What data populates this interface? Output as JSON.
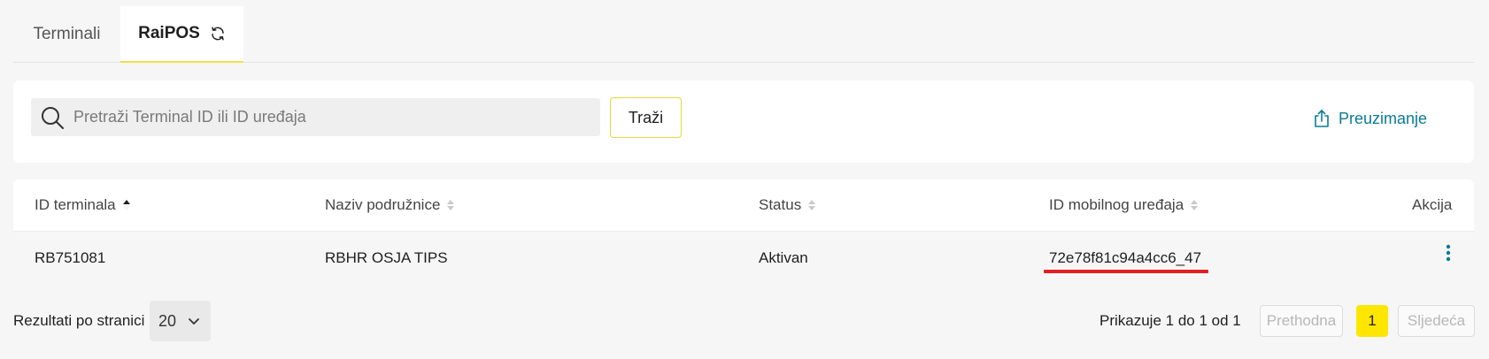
{
  "tabs": [
    {
      "label": "Terminali"
    },
    {
      "label": "RaiPOS"
    }
  ],
  "search": {
    "placeholder": "Pretraži Terminal ID ili ID uređaja",
    "button_label": "Traži",
    "download_label": "Preuzimanje"
  },
  "table": {
    "columns": [
      "ID terminala",
      "Naziv podružnice",
      "Status",
      "ID mobilnog uređaja",
      "Akcija"
    ],
    "rows": [
      {
        "terminal_id": "RB751081",
        "branch": "RBHR OSJA TIPS",
        "status": "Aktivan",
        "device_id": "72e78f81c94a4cc6_47"
      }
    ]
  },
  "pagination": {
    "per_page_label": "Rezultati po stranici",
    "per_page_value": "20",
    "showing_text": "Prikazuje 1 do 1 od 1",
    "prev_label": "Prethodna",
    "current_page": "1",
    "next_label": "Sljedeća"
  },
  "colors": {
    "accent_yellow": "#fee600",
    "link_teal": "#0b7c95",
    "highlight_red": "#e31e24"
  },
  "icons": {
    "refresh": "refresh-icon",
    "search": "search-icon",
    "download": "upload-icon",
    "sort": "sort-icon",
    "actions": "kebab-menu-icon",
    "dropdown": "chevron-down-icon"
  }
}
